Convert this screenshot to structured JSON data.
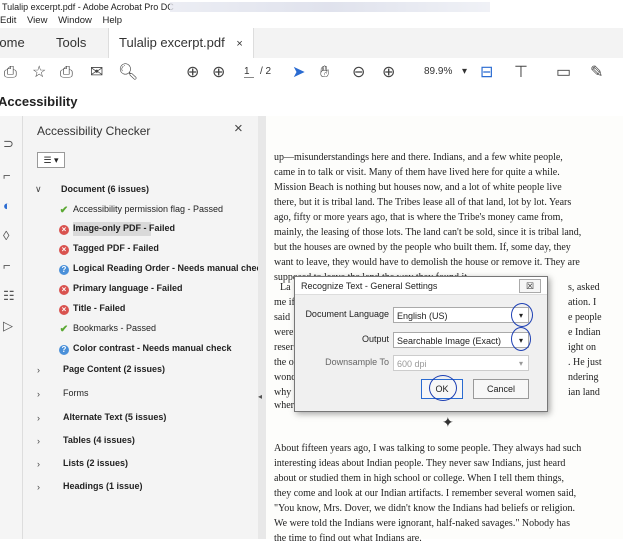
{
  "window": {
    "title": "Tulalip excerpt.pdf - Adobe Acrobat Pro DC",
    "menu": [
      "Edit",
      "View",
      "Window",
      "Help"
    ]
  },
  "tabs": {
    "home": "Home",
    "tools": "Tools",
    "doc": "Tulalip excerpt.pdf"
  },
  "toolbar": {
    "page_current": "1",
    "page_total": "/ 2",
    "zoom": "89.9%"
  },
  "accessibility_header": "Accessibility",
  "checker": {
    "title": "Accessibility Checker",
    "document": "Document (6 issues)",
    "items": [
      {
        "label": "Accessibility permission flag - Passed",
        "status": "pass",
        "selected": false
      },
      {
        "label": "Image-only PDF - Failed",
        "status": "fail",
        "selected": true
      },
      {
        "label": "Tagged PDF - Failed",
        "status": "fail",
        "selected": false
      },
      {
        "label": "Logical Reading Order - Needs manual check",
        "status": "manual",
        "selected": false
      },
      {
        "label": "Primary language - Failed",
        "status": "fail",
        "selected": false
      },
      {
        "label": "Title - Failed",
        "status": "fail",
        "selected": false
      },
      {
        "label": "Bookmarks - Passed",
        "status": "pass",
        "selected": false
      },
      {
        "label": "Color contrast - Needs manual check",
        "status": "manual",
        "selected": false
      }
    ],
    "groups": [
      "Page Content (2 issues)",
      "Forms",
      "Alternate Text (5 issues)",
      "Tables (4 issues)",
      "Lists (2 issues)",
      "Headings (1 issue)"
    ]
  },
  "page_text": [
    "up—misunderstandings here and there. Indians, and a few white people,",
    "came in to talk or visit. Many of them have lived here for quite a while.",
    "    Mission Beach is nothing but houses now, and a lot of white people live",
    "there, but it is tribal land. The Tribes lease all of that land, lot by lot. Years",
    "ago, fifty or more years ago, that is where the Tribe's money came from,",
    "mainly, the leasing of those lots. The land can't be sold, since it is tribal land,",
    "but the houses are owned by the people who built them. If, some day, they",
    "want to leave, they would have to demolish the house or remove it. They are",
    "supposed to leave the land the way they found it."
  ],
  "page_fragments_left": [
    "La",
    "me if",
    "said",
    "were",
    "reser",
    "the o",
    "wond",
    "why",
    "wher"
  ],
  "page_fragments_right": [
    "s, asked",
    "ation. I",
    "e people",
    "e Indian",
    "ight on",
    ". He just",
    "ndering",
    "ian land"
  ],
  "page_text_bottom": [
    "About fifteen years ago, I was talking to some people. They always had such",
    "interesting ideas about Indian people. They never saw Indians, just heard",
    "about or studied them in high school or college. When I tell them things,",
    "they come and look at our Indian artifacts. I remember several women said,",
    "\"You know, Mrs. Dover, we didn't know the Indians had beliefs or religion.",
    "We were told the Indians were ignorant, half-naked savages.\" Nobody has",
    "the time to find out what Indians are."
  ],
  "dialog": {
    "title": "Recognize Text - General Settings",
    "close": "☒",
    "language_label": "Document Language",
    "language_value": "English (US)",
    "output_label": "Output",
    "output_value": "Searchable Image (Exact)",
    "downsample_label": "Downsample To",
    "downsample_value": "600 dpi",
    "ok": "OK",
    "cancel": "Cancel"
  }
}
